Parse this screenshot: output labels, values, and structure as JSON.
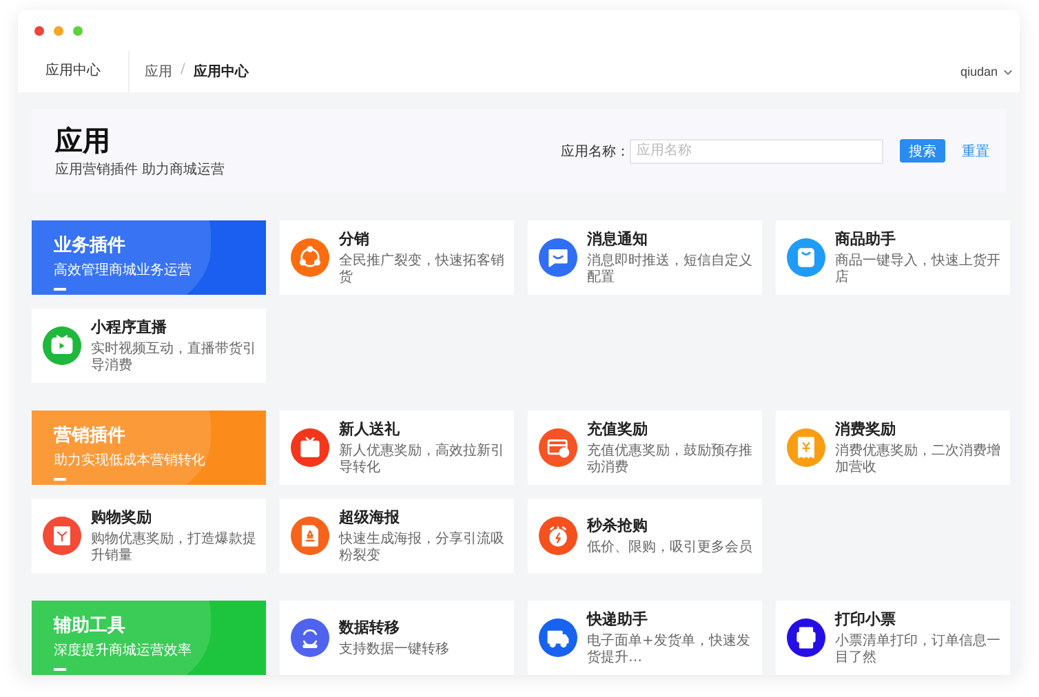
{
  "window": {
    "nav_title": "应用中心",
    "breadcrumb": [
      "应用",
      "/",
      "应用中心"
    ],
    "user": "qiudan"
  },
  "header": {
    "title": "应用",
    "subtitle": "应用营销插件 助力商城运营",
    "search_label": "应用名称：",
    "search": {
      "placeholder": "应用名称"
    },
    "search_button": "搜索",
    "reset_link": "重置"
  },
  "sections": [
    {
      "title": "业务插件",
      "subtitle": "高效管理商城业务运营",
      "color": "#1a5ff0",
      "apps": [
        {
          "title": "分销",
          "desc": "全民推广裂变，快速拓客销货",
          "color": "#fb6d10"
        },
        {
          "title": "消息通知",
          "desc": "消息即时推送，短信自定义配置",
          "color": "#2f6ef5"
        },
        {
          "title": "商品助手",
          "desc": "商品一键导入，快速上货开店",
          "color": "#1e9cf7"
        },
        {
          "title": "小程序直播",
          "desc": "实时视频互动，直播带货引导消费",
          "color": "#1eb83a"
        }
      ]
    },
    {
      "title": "营销插件",
      "subtitle": "助力实现低成本营销转化",
      "color": "#fb8c1c",
      "apps": [
        {
          "title": "新人送礼",
          "desc": "新人优惠奖励，高效拉新引导转化",
          "color": "#f3361c"
        },
        {
          "title": "充值奖励",
          "desc": "充值优惠奖励，鼓励预存推动消费",
          "color": "#f65424"
        },
        {
          "title": "消费奖励",
          "desc": "消费优惠奖励，二次消费增加营收",
          "color": "#f99e12"
        },
        {
          "title": "购物奖励",
          "desc": "购物优惠奖励，打造爆款提升销量",
          "color": "#f44a36"
        },
        {
          "title": "超级海报",
          "desc": "快速生成海报，分享引流吸粉裂变",
          "color": "#f5641a"
        },
        {
          "title": "秒杀抢购",
          "desc": "低价、限购，吸引更多会员",
          "color": "#f6501e"
        }
      ]
    },
    {
      "title": "辅助工具",
      "subtitle": "深度提升商城运营效率",
      "color": "#1dc53f",
      "apps": [
        {
          "title": "数据转移",
          "desc": "支持数据一键转移",
          "color": "#4f63ee"
        },
        {
          "title": "快递助手",
          "desc": "电子面单+发货单，快速发货提升…",
          "color": "#1763f0"
        },
        {
          "title": "打印小票",
          "desc": "小票清单打印，订单信息一目了然",
          "color": "#2410e6"
        }
      ]
    }
  ]
}
